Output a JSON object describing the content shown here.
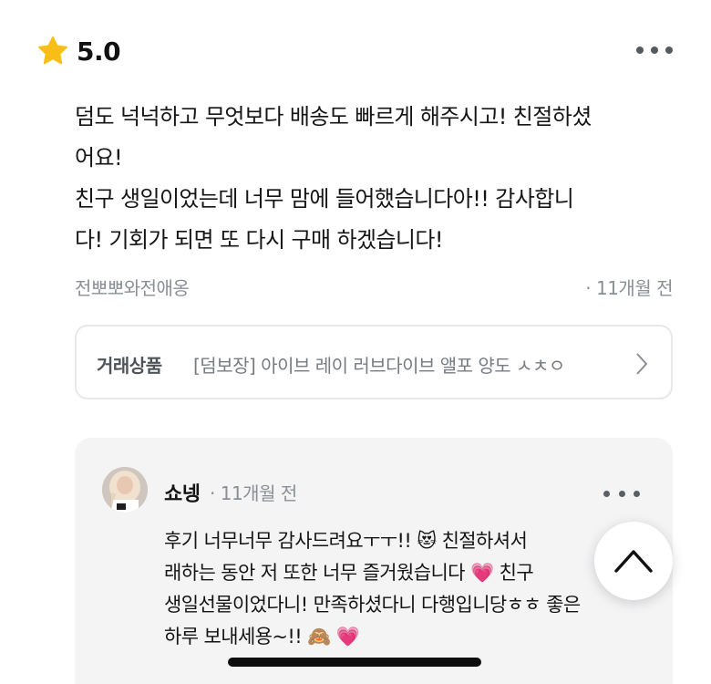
{
  "review": {
    "rating": "5.0",
    "rating_icon": "star-icon",
    "lines": [
      "덤도 넉넉하고 무엇보다 배송도 빠르게 해주시고! 친절하셨",
      "어요!",
      "친구 생일이었는데 너무 맘에 들어했습니다아!! 감사합니",
      "다! 기회가 되면 또 다시 구매 하겠습니다!"
    ],
    "reviewer": "전뽀뽀와전애옹",
    "time": "· 11개월 전"
  },
  "product": {
    "label": "거래상품",
    "title": "[덤보장] 아이브 레이 러브다이브 앨포 양도 ㅅㅊㅇ"
  },
  "reply": {
    "seller": "쇼넹",
    "time": "· 11개월 전",
    "lines": [
      "후기 너무너무 감사드려요ㅜㅜ!! 😻    친절하셔서",
      "래하는 동안 저 또한 너무 즐거웠습니다 💗     친구",
      "생일선물이었다니! 만족하셨다니 다행입니당ㅎㅎ 좋은",
      "하루 보내세용~!! 🙈 💗"
    ]
  },
  "colors": {
    "star": "#F9BE15",
    "text_primary": "#111111",
    "text_secondary": "#8A8F96",
    "reply_background": "#F4F4F5"
  }
}
